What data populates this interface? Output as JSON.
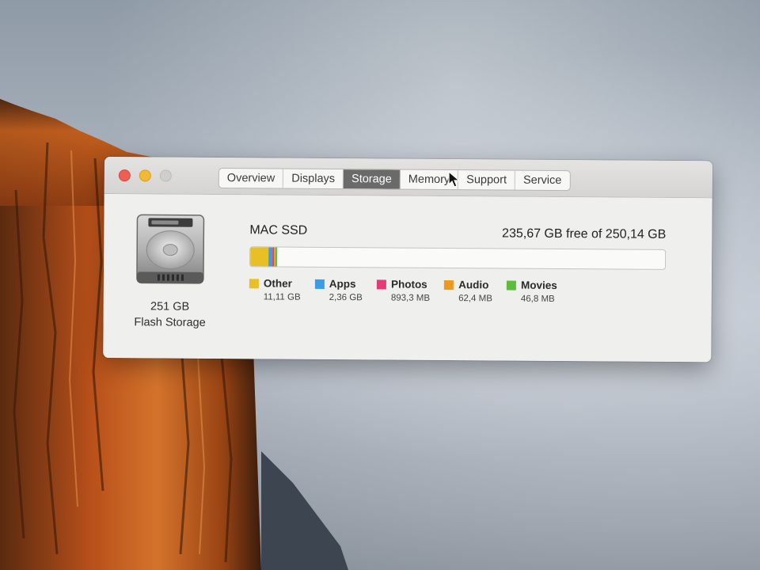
{
  "tabs": {
    "overview": "Overview",
    "displays": "Displays",
    "storage": "Storage",
    "memory": "Memory",
    "support": "Support",
    "service": "Service",
    "active": "Storage"
  },
  "drive": {
    "size": "251 GB",
    "type": "Flash Storage",
    "icon": "hard-drive-icon"
  },
  "volume": {
    "name": "MAC SSD",
    "free_text": "235,67 GB free of 250,14 GB"
  },
  "usage_bar": {
    "total_gb": 250.14,
    "segments": [
      {
        "key": "other",
        "gb": 11.11,
        "color": "#e9bf26"
      },
      {
        "key": "apps",
        "gb": 2.36,
        "color": "#3a9ee2"
      },
      {
        "key": "photos",
        "gb": 0.8933,
        "color": "#e53a78"
      },
      {
        "key": "audio",
        "gb": 0.0624,
        "color": "#eb9a1e"
      },
      {
        "key": "movies",
        "gb": 0.0468,
        "color": "#5cbd3d"
      }
    ]
  },
  "legend": {
    "other": {
      "label": "Other",
      "size": "11,11 GB",
      "color": "#e9bf26"
    },
    "apps": {
      "label": "Apps",
      "size": "2,36 GB",
      "color": "#3a9ee2"
    },
    "photos": {
      "label": "Photos",
      "size": "893,3 MB",
      "color": "#e53a78"
    },
    "audio": {
      "label": "Audio",
      "size": "62,4 MB",
      "color": "#eb9a1e"
    },
    "movies": {
      "label": "Movies",
      "size": "46,8 MB",
      "color": "#5cbd3d"
    }
  },
  "window_controls": {
    "close": "close-icon",
    "minimize": "minimize-icon",
    "zoom": "zoom-icon"
  }
}
